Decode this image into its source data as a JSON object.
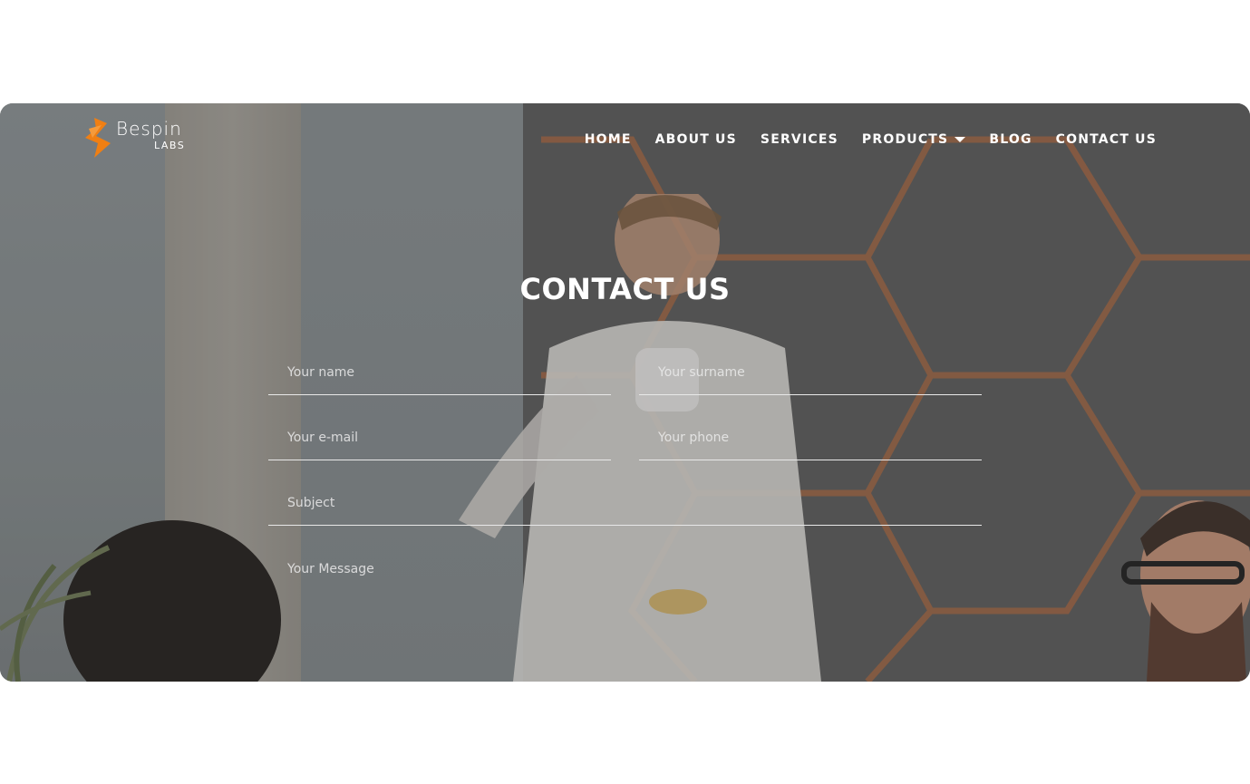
{
  "brand": {
    "name": "Bespin",
    "sub": "LABS",
    "logo_color": "#f07f13"
  },
  "nav": {
    "items": [
      {
        "label": "HOME"
      },
      {
        "label": "ABOUT US"
      },
      {
        "label": "SERVICES"
      },
      {
        "label": "PRODUCTS",
        "has_dropdown": true
      },
      {
        "label": "BLOG"
      },
      {
        "label": "CONTACT US"
      }
    ]
  },
  "hero": {
    "title": "CONTACT US"
  },
  "form": {
    "name_placeholder": "Your name",
    "surname_placeholder": "Your surname",
    "email_placeholder": "Your e-mail",
    "phone_placeholder": "Your phone",
    "subject_placeholder": "Subject",
    "message_placeholder": "Your Message"
  },
  "colors": {
    "accent": "#f07f13",
    "text": "#ffffff",
    "wall_lines": "#c0703d"
  }
}
